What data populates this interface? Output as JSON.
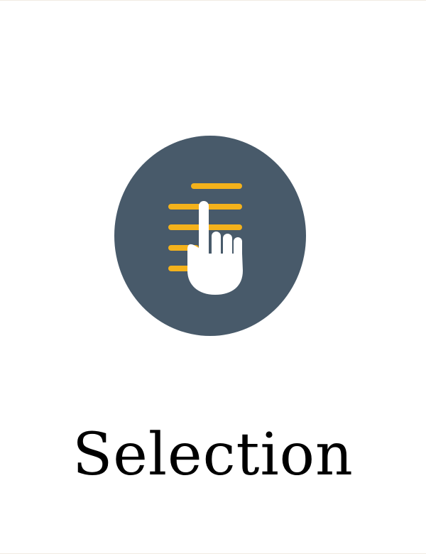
{
  "caption": {
    "title": "Selection"
  },
  "icon": {
    "name": "list-selection-hand-icon",
    "circle_color": "#485a6a",
    "line_color": "#f4b21b",
    "hand_color": "#ffffff"
  }
}
